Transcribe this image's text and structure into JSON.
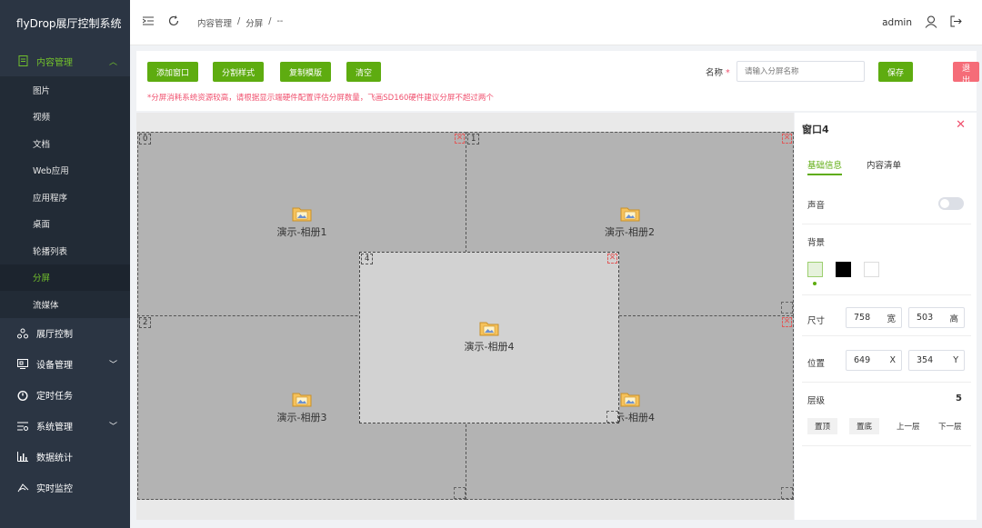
{
  "app": {
    "brand": "flyDrop展厅控制系统"
  },
  "sidebar": {
    "content_menu": {
      "label": "内容管理",
      "icon": "document-icon"
    },
    "sub_items": [
      "图片",
      "视频",
      "文档",
      "Web应用",
      "应用程序",
      "桌面",
      "轮播列表",
      "分屏",
      "流媒体"
    ],
    "active_sub": "分屏",
    "groups": [
      {
        "label": "展厅控制",
        "icon": "network-icon",
        "has_arrow": false
      },
      {
        "label": "设备管理",
        "icon": "device-icon",
        "has_arrow": true
      },
      {
        "label": "定时任务",
        "icon": "clock-icon",
        "has_arrow": false
      },
      {
        "label": "系统管理",
        "icon": "settings-icon",
        "has_arrow": true
      },
      {
        "label": "数据统计",
        "icon": "bar-chart-icon",
        "has_arrow": false
      },
      {
        "label": "实时监控",
        "icon": "monitor-icon",
        "has_arrow": false
      }
    ]
  },
  "header": {
    "breadcrumb": [
      "内容管理",
      "/",
      "分屏",
      "/",
      "--"
    ],
    "user": "admin"
  },
  "toolbar": {
    "add_window": "添加窗口",
    "split_style": "分割样式",
    "copy_template": "复制模版",
    "clear": "清空",
    "warning": "*分屏消耗系统资源较高，请根据显示端硬件配置评估分屏数量，飞画SD160硬件建议分屏不超过两个",
    "name_label": "名称",
    "name_required_mark": "*",
    "name_placeholder": "请输入分屏名称",
    "save": "保存",
    "exit": "退出"
  },
  "windows": [
    {
      "num": "0",
      "title": "演示-相册1"
    },
    {
      "num": "1",
      "title": "演示-相册2"
    },
    {
      "num": "2",
      "title": "演示-相册3"
    },
    {
      "num": "3",
      "title": "演示-相册4"
    },
    {
      "num": "4",
      "title": "演示-相册4"
    }
  ],
  "panel": {
    "title": "窗口4",
    "tabs": [
      "基础信息",
      "内容清单"
    ],
    "sound_label": "声音",
    "sound_on": false,
    "background_label": "背景",
    "background_colors": [
      "#e6f2dc",
      "#000000",
      "#ffffff"
    ],
    "size_label": "尺寸",
    "width": "758",
    "width_unit": "宽",
    "height": "503",
    "height_unit": "高",
    "position_label": "位置",
    "pos_x": "649",
    "pos_x_unit": "X",
    "pos_y": "354",
    "pos_y_unit": "Y",
    "layer_label": "层级",
    "layer_value": "5",
    "layer_buttons": [
      "置顶",
      "置底",
      "上一层",
      "下一层"
    ]
  },
  "colors": {
    "accent": "#5eac10",
    "danger": "#f56c78",
    "sidebar_bg": "#2b3543"
  }
}
